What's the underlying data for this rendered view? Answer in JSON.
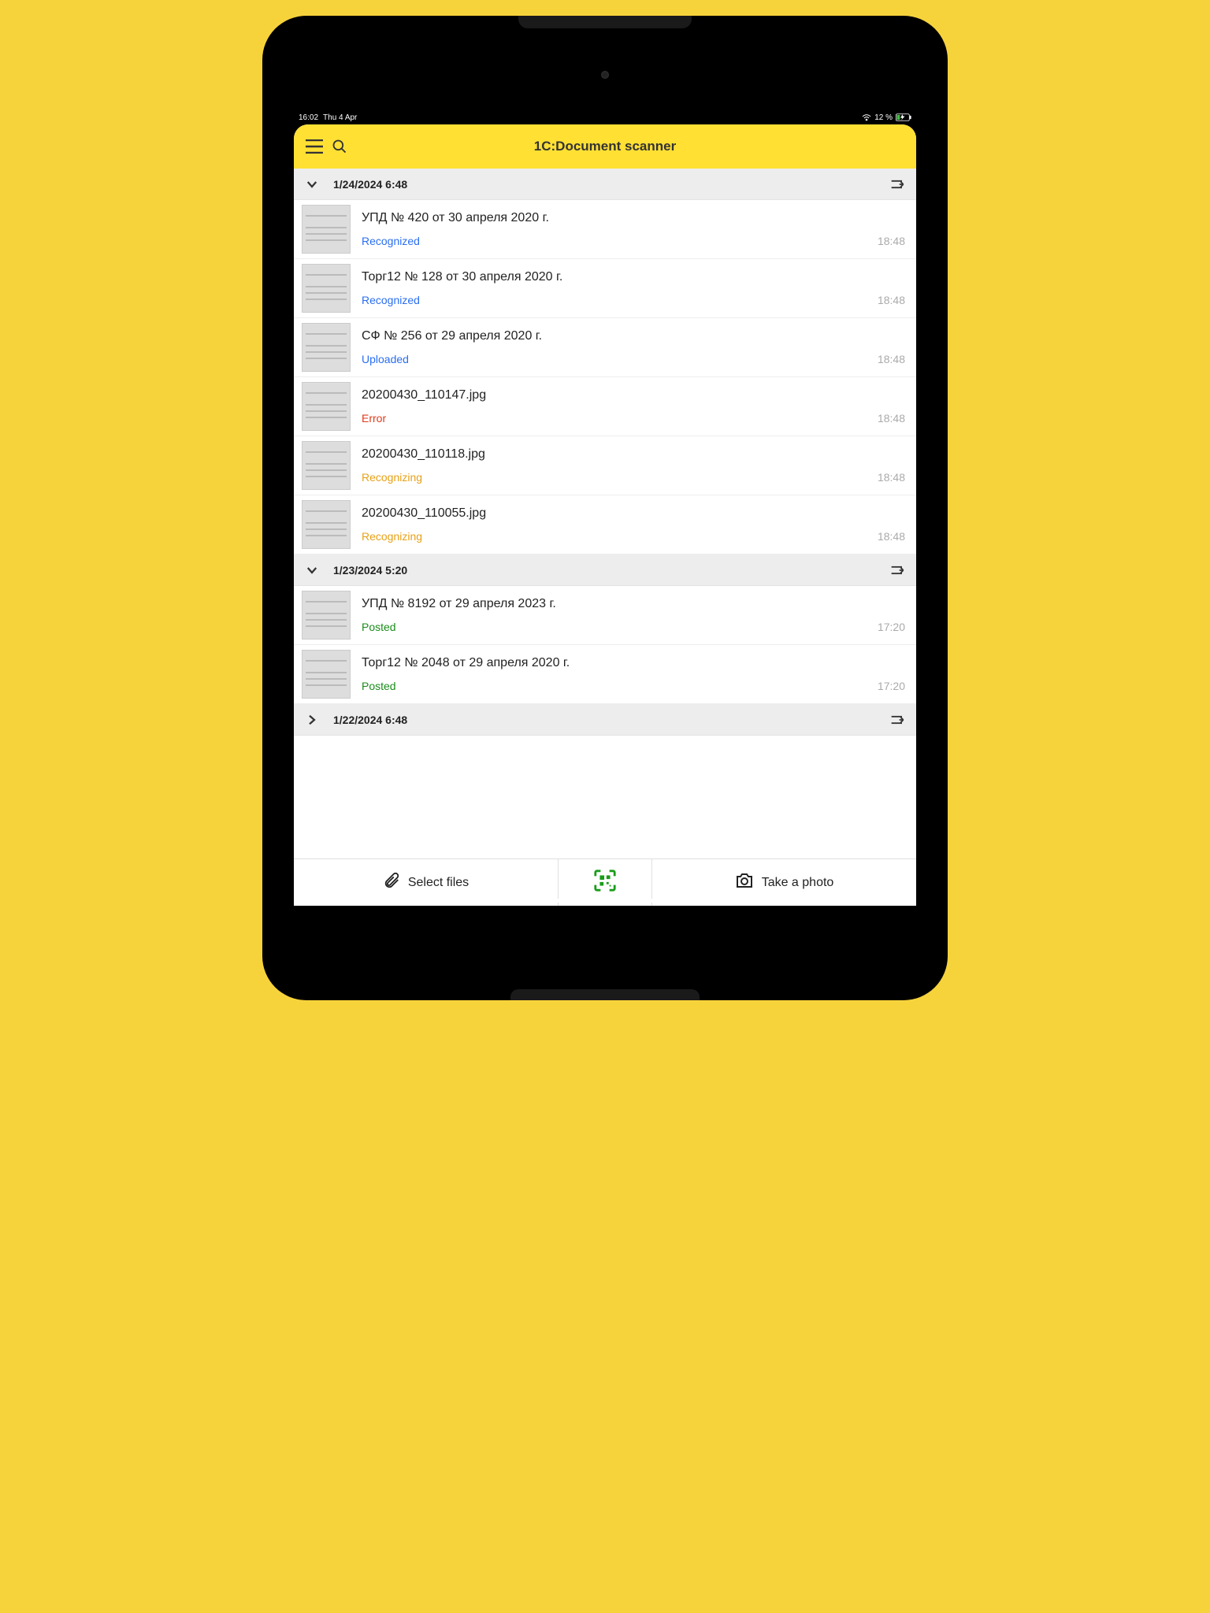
{
  "status_bar": {
    "time": "16:02",
    "date": "Thu 4 Apr",
    "battery_pct": "12 %"
  },
  "header": {
    "title": "1C:Document scanner"
  },
  "groups": [
    {
      "id": "g1",
      "expanded": true,
      "date": "1/24/2024 6:48",
      "items": [
        {
          "title": "УПД № 420 от 30 апреля 2020 г.",
          "status": "Recognized",
          "status_class": "st-recognized",
          "time": "18:48"
        },
        {
          "title": "Торг12 № 128 от 30 апреля 2020 г.",
          "status": "Recognized",
          "status_class": "st-recognized",
          "time": "18:48"
        },
        {
          "title": "СФ № 256 от 29 апреля 2020 г.",
          "status": "Uploaded",
          "status_class": "st-uploaded",
          "time": "18:48"
        },
        {
          "title": "20200430_110147.jpg",
          "status": "Error",
          "status_class": "st-error",
          "time": "18:48"
        },
        {
          "title": "20200430_110118.jpg",
          "status": "Recognizing",
          "status_class": "st-recognizing",
          "time": "18:48"
        },
        {
          "title": "20200430_110055.jpg",
          "status": "Recognizing",
          "status_class": "st-recognizing",
          "time": "18:48"
        }
      ]
    },
    {
      "id": "g2",
      "expanded": true,
      "date": "1/23/2024 5:20",
      "items": [
        {
          "title": "УПД № 8192 от 29 апреля 2023 г.",
          "status": "Posted",
          "status_class": "st-posted",
          "time": "17:20"
        },
        {
          "title": "Торг12 № 2048 от 29 апреля 2020 г.",
          "status": "Posted",
          "status_class": "st-posted",
          "time": "17:20"
        }
      ]
    },
    {
      "id": "g3",
      "expanded": false,
      "date": "1/22/2024 6:48",
      "items": []
    }
  ],
  "bottom": {
    "select_files": "Select files",
    "take_photo": "Take a photo"
  }
}
